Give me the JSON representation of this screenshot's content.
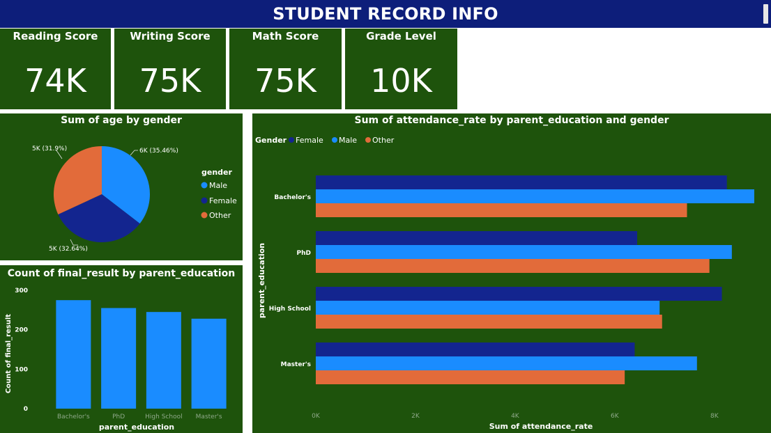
{
  "header": {
    "title": "STUDENT RECORD INFO"
  },
  "kpis": [
    {
      "label": "Reading Score",
      "value": "74K"
    },
    {
      "label": "Writing Score",
      "value": "75K"
    },
    {
      "label": "Math Score",
      "value": "75K"
    },
    {
      "label": "Grade Level",
      "value": "10K"
    }
  ],
  "colors": {
    "header_bg": "#0d1e7a",
    "panel_bg": "#1e530c",
    "female": "#13258f",
    "male": "#1a8cff",
    "other": "#e26b3a"
  },
  "chart_data": [
    {
      "type": "pie",
      "title": "Sum of age by gender",
      "legend_title": "gender",
      "legend_position": "right",
      "slices": [
        {
          "name": "Male",
          "value": 6000,
          "percent": 35.46,
          "label": "6K (35.46%)"
        },
        {
          "name": "Female",
          "value": 5000,
          "percent": 32.64,
          "label": "5K (32.64%)"
        },
        {
          "name": "Other",
          "value": 5000,
          "percent": 31.9,
          "label": "5K (31.9%)"
        }
      ]
    },
    {
      "type": "bar",
      "title": "Count of final_result by parent_education",
      "xlabel": "parent_education",
      "ylabel": "Count of final_result",
      "categories": [
        "Bachelor's",
        "PhD",
        "High School",
        "Master's"
      ],
      "values": [
        275,
        255,
        245,
        228
      ],
      "ylim": [
        0,
        300
      ],
      "yticks": [
        "0",
        "100",
        "200",
        "300"
      ],
      "grid": false
    },
    {
      "type": "bar",
      "orientation": "horizontal",
      "title": "Sum of attendance_rate by parent_education and gender",
      "legend_title": "Gender",
      "legend_position": "top-left",
      "xlabel": "Sum of attendance_rate",
      "ylabel": "parent_education",
      "categories": [
        "Bachelor's",
        "PhD",
        "High School",
        "Master's"
      ],
      "series": [
        {
          "name": "Female",
          "values": [
            8250,
            6450,
            8150,
            6400
          ]
        },
        {
          "name": "Male",
          "values": [
            8800,
            8350,
            6900,
            7650
          ]
        },
        {
          "name": "Other",
          "values": [
            7450,
            7900,
            6950,
            6200
          ]
        }
      ],
      "xlim": [
        0,
        8800
      ],
      "xticks": [
        {
          "value": 0,
          "label": "0K"
        },
        {
          "value": 2000,
          "label": "2K"
        },
        {
          "value": 4000,
          "label": "4K"
        },
        {
          "value": 6000,
          "label": "6K"
        },
        {
          "value": 8000,
          "label": "8K"
        }
      ],
      "grid": false
    }
  ]
}
